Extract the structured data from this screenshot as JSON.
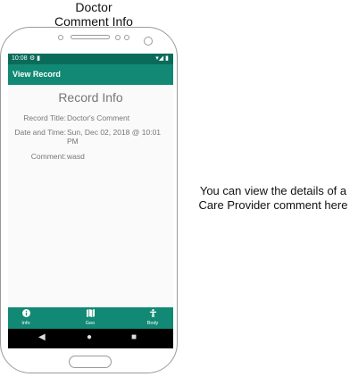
{
  "caption": {
    "top_line1": "Doctor",
    "top_line2": "Comment Info",
    "side_line1": "You can view the details of a",
    "side_line2": "Care Provider comment here"
  },
  "statusbar": {
    "time": "10:08",
    "left_icons": "⚙ ▮",
    "right_icons": "▾◢ ▮"
  },
  "appbar": {
    "title": "View Record"
  },
  "record": {
    "header": "Record Info",
    "title_label": "Record Title:",
    "title_value": "Doctor's Comment",
    "datetime_label": "Date and Time:",
    "datetime_value": "Sun, Dec 02, 2018 @ 10:01 PM",
    "comment_label": "Comment:",
    "comment_value": "wasd"
  },
  "bottom_nav": [
    {
      "label": "Info",
      "icon": "info-icon"
    },
    {
      "label": "Geo",
      "icon": "map-icon"
    },
    {
      "label": "Body",
      "icon": "body-icon"
    }
  ],
  "system_nav": [
    "back-icon",
    "home-icon",
    "recents-icon"
  ],
  "colors": {
    "primary": "#128974",
    "primary_dark": "#0b6b5a",
    "text_secondary": "#777777"
  }
}
